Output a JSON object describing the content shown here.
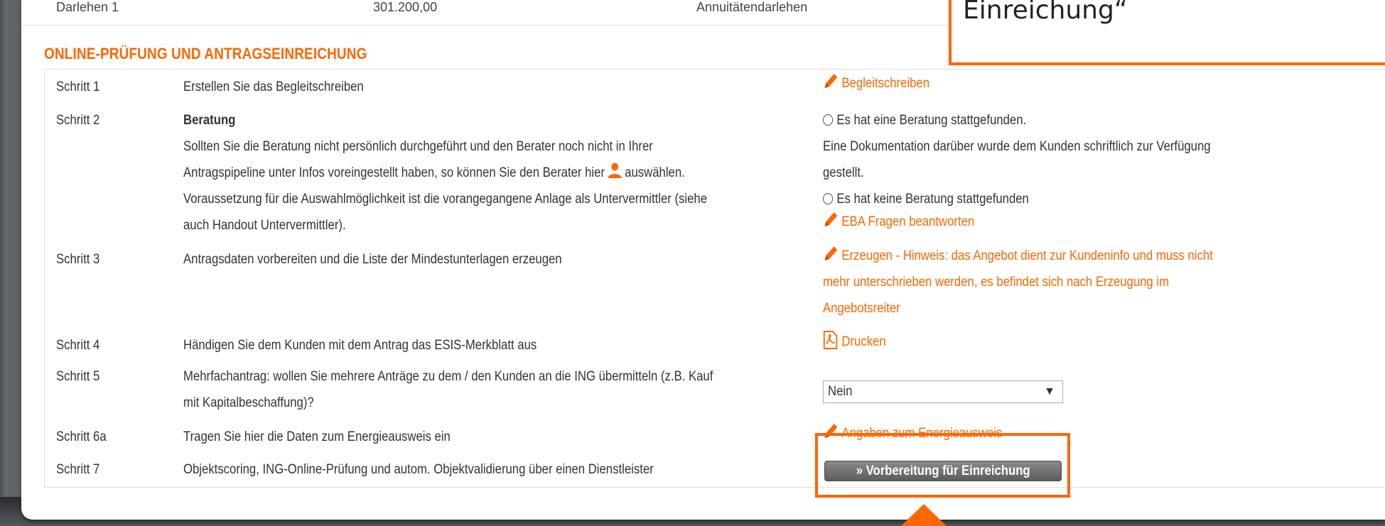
{
  "top_row": {
    "label": "Darlehen 1",
    "amount": "301.200,00",
    "type": "Annuitätendarlehen"
  },
  "callout": {
    "text": "Einreichung“"
  },
  "section": {
    "title": "ONLINE-PRÜFUNG UND ANTRAGSEINREICHUNG"
  },
  "steps": [
    {
      "label": "Schritt 1",
      "desc": [
        "Erstellen Sie das Begleitschreiben"
      ],
      "action": "Begleitschreiben"
    },
    {
      "label": "Schritt 2",
      "desc_title": "Beratung",
      "desc": [
        "Sollten Sie die Beratung nicht persönlich durchgeführt und den Berater noch nicht in Ihrer",
        "Antragspipeline unter Infos voreingestellt haben, so können Sie den Berater hier",
        "auswählen.",
        "Voraussetzung für die Auswahlmöglichkeit ist die vorangegangene Anlage als Untervermittler (siehe",
        "auch Handout Untervermittler)."
      ],
      "radio_yes": "Es hat eine Beratung stattgefunden.",
      "radio_yes_note_1": "Eine Dokumentation darüber wurde dem Kunden schriftlich zur Verfügung",
      "radio_yes_note_2": "gestellt.",
      "radio_no": "Es hat keine Beratung stattgefunden",
      "action": "EBA Fragen beantworten"
    },
    {
      "label": "Schritt 3",
      "desc": [
        "Antragsdaten vorbereiten und die Liste der Mindestunterlagen erzeugen"
      ],
      "action": [
        "Erzeugen - Hinweis: das Angebot dient zur Kundeninfo und muss nicht",
        "mehr unterschrieben werden, es befindet sich nach Erzeugung im",
        "Angebotsreiter"
      ]
    },
    {
      "label": "Schritt 4",
      "desc": [
        "Händigen Sie dem Kunden mit dem Antrag das ESIS-Merkblatt aus"
      ],
      "action": "Drucken"
    },
    {
      "label": "Schritt 5",
      "desc": [
        "Mehrfachantrag: wollen Sie mehrere Anträge zu dem / den Kunden an die ING übermitteln (z.B. Kauf",
        "mit Kapitalbeschaffung)?"
      ],
      "select_value": "Nein"
    },
    {
      "label": "Schritt 6a",
      "desc": [
        "Tragen Sie hier die Daten zum Energieausweis ein"
      ],
      "action": "Angaben zum Energieausweis"
    },
    {
      "label": "Schritt 7",
      "desc": [
        "Objektscoring, ING-Online-Prüfung und autom. Objektvalidierung über einen Dienstleister"
      ],
      "button": "» Vorbereitung für Einreichung"
    }
  ],
  "colors": {
    "accent": "#ff6600",
    "text": "#333333",
    "button": "#6e6e6e"
  }
}
